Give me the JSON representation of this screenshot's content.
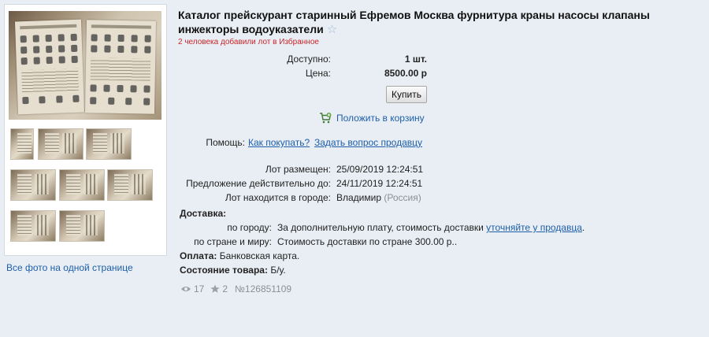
{
  "photos": {
    "all_photos_link": "Все фото на одной странице"
  },
  "lot": {
    "title": "Каталог прейскурант старинный Ефремов Москва фурнитура краны насосы клапаны инжекторы водоуказатели",
    "favorites_note": "2 человека добавили лот в Избранное",
    "available_label": "Доступно:",
    "available_value": "1 шт.",
    "price_label": "Цена:",
    "price_value": "8500.00 р",
    "buy_label": "Купить",
    "cart_label": "Положить в корзину",
    "help_label": "Помощь:",
    "help_how_to_buy": "Как покупать?",
    "help_ask_seller": "Задать вопрос продавцу",
    "placed_label": "Лот размещен:",
    "placed_value": "25/09/2019 12:24:51",
    "valid_label": "Предложение действительно до:",
    "valid_value": "24/11/2019 12:24:51",
    "city_label": "Лот находится в городе:",
    "city_value": "Владимир",
    "country_value": "(Россия)",
    "delivery_heading": "Доставка:",
    "delivery_city_label": "по городу:",
    "delivery_city_text": "За дополнительную плату, стоимость доставки",
    "delivery_city_link": "уточняйте у продавца",
    "delivery_city_end": ".",
    "delivery_country_label": "по стране и миру:",
    "delivery_country_text": "Стоимость доставки по стране 300.00 р..",
    "payment_label": "Оплата:",
    "payment_value": "Банковская карта.",
    "condition_label": "Состояние товара:",
    "condition_value": "Б/у.",
    "views": "17",
    "stars": "2",
    "lot_number": "№126851109"
  },
  "icons": {
    "views": "eye-icon",
    "stars": "star-icon",
    "cart": "cart-icon",
    "favorite": "favorite-star-icon"
  },
  "colors": {
    "link": "#1d5fa8",
    "favorites_note": "#c8262a",
    "background": "#e9eef4"
  }
}
